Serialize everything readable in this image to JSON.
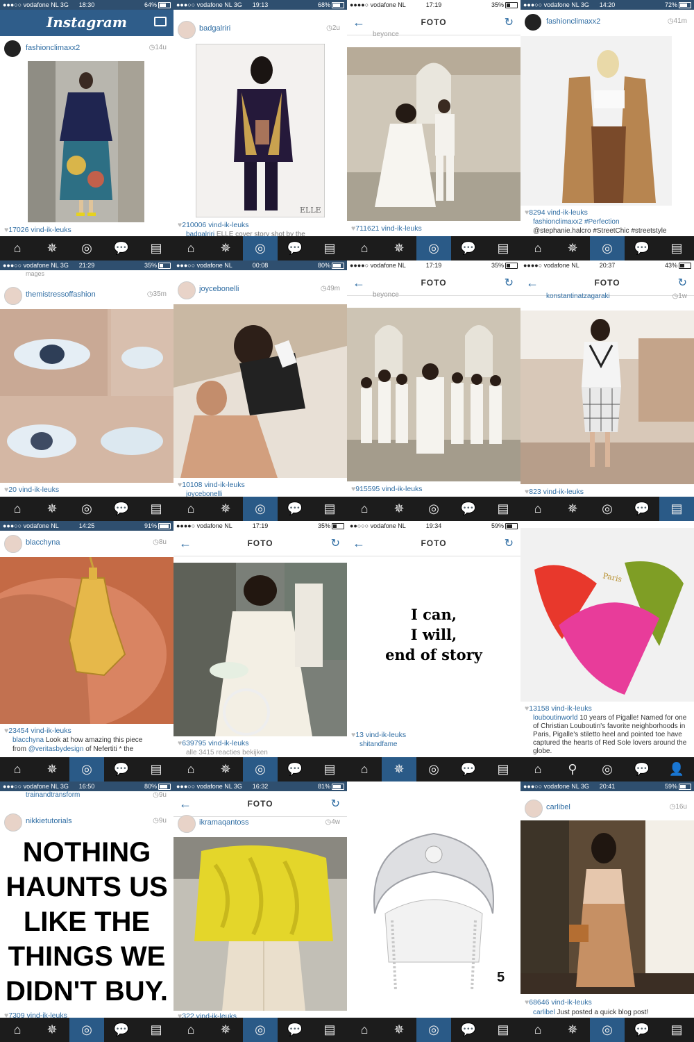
{
  "tiles": [
    {
      "id": "t1",
      "carrier": "●●●○○ vodafone NL  3G",
      "time": "18:30",
      "battery": "64%",
      "battery_level": 0.64,
      "header": "Instagram",
      "user": "fashionclimaxx2",
      "age": "14u",
      "likes": "17026 vind-ik-leuks"
    },
    {
      "id": "t2",
      "carrier": "●●●○○ vodafone NL  3G",
      "time": "19:13",
      "battery": "68%",
      "battery_level": 0.68,
      "user": "badgalriri",
      "age": "2u",
      "likes": "210006 vind-ik-leuks",
      "caption_user": "badgalriri",
      "caption": "ELLE cover story shot by the",
      "watermark": "ELLE"
    },
    {
      "id": "t3",
      "carrier": "●●●●○ vodafone NL",
      "time": "17:19",
      "battery": "35%",
      "battery_level": 0.35,
      "nav_title": "FOTO",
      "user_partial": "beyonce",
      "likes": "711621 vind-ik-leuks"
    },
    {
      "id": "t4",
      "carrier": "●●●○○ vodafone NL  3G",
      "time": "14:20",
      "battery": "72%",
      "battery_level": 0.72,
      "user": "fashionclimaxx2",
      "age": "41m",
      "likes": "8294 vind-ik-leuks",
      "caption_user": "fashionclimaxx2",
      "caption": "#Perfection",
      "caption2": "@stephanie.halcro #StreetChic #streetstyle"
    },
    {
      "id": "t5",
      "carrier": "●●●○○ vodafone NL  3G",
      "time": "21:29",
      "battery": "35%",
      "battery_level": 0.35,
      "user": "themistressoffashion",
      "age": "35m",
      "likes": "20 vind-ik-leuks",
      "top_partial": "mages"
    },
    {
      "id": "t6",
      "carrier": "●●●○○ vodafone NL",
      "time": "00:08",
      "battery": "80%",
      "battery_level": 0.8,
      "user": "joycebonelli",
      "age": "49m",
      "likes": "10108 vind-ik-leuks",
      "caption_user": "joycebonelli"
    },
    {
      "id": "t7",
      "carrier": "●●●●○ vodafone NL",
      "time": "17:19",
      "battery": "35%",
      "battery_level": 0.35,
      "nav_title": "FOTO",
      "user_partial": "beyonce",
      "likes": "915595 vind-ik-leuks"
    },
    {
      "id": "t8",
      "carrier": "●●●●○ vodafone NL",
      "time": "20:37",
      "battery": "43%",
      "battery_level": 0.43,
      "nav_title": "FOTO",
      "user_partial": "konstantinatzagaraki",
      "age": "1w",
      "likes": "823 vind-ik-leuks"
    },
    {
      "id": "t9",
      "carrier": "●●●○○ vodafone NL",
      "time": "14:25",
      "battery": "91%",
      "battery_level": 0.91,
      "user": "blacchyna",
      "age": "8u",
      "likes": "23454 vind-ik-leuks",
      "caption_user": "blacchyna",
      "caption": "Look at how amazing this piece",
      "caption2a": "from",
      "caption2b": "@veritasbydesign",
      "caption2c": "of Nefertiti * the"
    },
    {
      "id": "t10",
      "carrier": "●●●●○ vodafone NL",
      "time": "17:19",
      "battery": "35%",
      "battery_level": 0.35,
      "nav_title": "FOTO",
      "likes": "639795 vind-ik-leuks",
      "comments": "alle 3415 reacties bekijken"
    },
    {
      "id": "t11",
      "carrier": "●●○○○ vodafone NL",
      "time": "19:34",
      "battery": "59%",
      "battery_level": 0.59,
      "nav_title": "FOTO",
      "quote1": "I can,",
      "quote2": "I will,",
      "quote3": "end of story",
      "likes": "13 vind-ik-leuks",
      "caption_user": "shitandfame"
    },
    {
      "id": "t12",
      "likes": "13158 vind-ik-leuks",
      "caption_user": "louboutinworld",
      "caption": "10 years of Pigalle! Named for one of Christian Louboutin's favorite neighborhoods in Paris, Pigalle's stiletto heel and pointed toe have captured the hearts of Red Sole lovers around the globe.",
      "shoe_label": "Paris"
    },
    {
      "id": "t13",
      "carrier": "●●●○○ vodafone NL  3G",
      "time": "16:50",
      "battery": "80%",
      "battery_level": 0.8,
      "top_partial": "trainandtransform",
      "top_age": "9u",
      "user": "nikkietutorials",
      "age": "9u",
      "big1": "NOTHING",
      "big2": "HAUNTS US",
      "big3": "LIKE THE",
      "big4": "THINGS WE",
      "big5": "DIDN'T BUY.",
      "likes": "7309 vind-ik-leuks"
    },
    {
      "id": "t14",
      "carrier": "●●●○○ vodafone NL  3G",
      "time": "16:32",
      "battery": "81%",
      "battery_level": 0.81,
      "nav_title": "FOTO",
      "user": "ikramaqantoss",
      "age": "4w",
      "likes": "322 vind-ik-leuks"
    },
    {
      "id": "t15",
      "number": "5"
    },
    {
      "id": "t16",
      "carrier": "●●●○○ vodafone NL  3G",
      "time": "20:41",
      "battery": "59%",
      "battery_level": 0.59,
      "user": "carlibel",
      "age": "16u",
      "likes": "68646 vind-ik-leuks",
      "caption_user": "carlibel",
      "caption": "Just posted a quick blog post!"
    }
  ],
  "colors": {
    "accent": "#2f6da3",
    "tabbar": "#1c1c1c",
    "active_tab": "#2a5a87"
  },
  "icons": [
    "home-icon",
    "explore-icon",
    "camera-icon",
    "activity-icon",
    "profile-icon",
    "search-icon",
    "person-icon"
  ]
}
